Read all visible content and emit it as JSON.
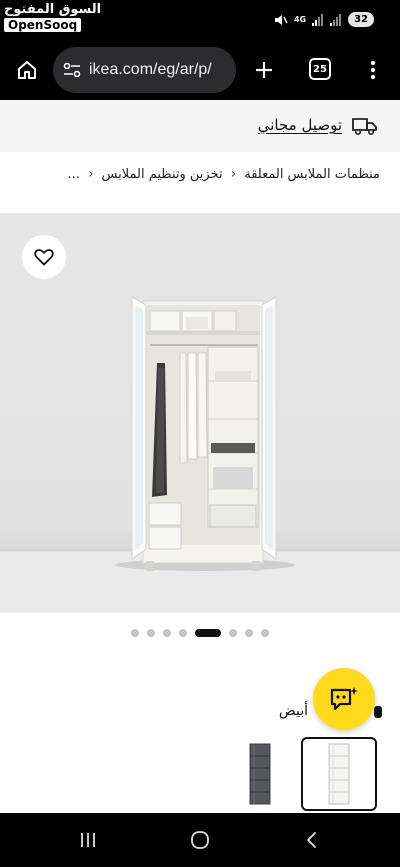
{
  "status_bar": {
    "watermark_ar": "السوق المفتوح",
    "watermark_en": "OpenSooq",
    "network": "4G",
    "battery": "32"
  },
  "browser": {
    "url": "ikea.com/eg/ar/p/",
    "tab_count": "25"
  },
  "delivery_banner": {
    "text": "توصيل مجاني"
  },
  "breadcrumb": {
    "items": [
      "...",
      "تخزين وتنظيم الملابس",
      "منظمات الملابس المعلقة"
    ]
  },
  "gallery": {
    "image_count": 8,
    "active_index": 4
  },
  "product": {
    "color_label": "أبيض",
    "variants": [
      {
        "name": "white-hanging-organizer",
        "selected": true
      },
      {
        "name": "gray-hanging-organizer",
        "selected": false
      }
    ]
  },
  "colors": {
    "accent_yellow": "#ffda1a",
    "status_bg": "#000000",
    "banner_bg": "#f5f5f5"
  },
  "icons": [
    "home-icon",
    "site-settings-icon",
    "add-tab-icon",
    "tab-count-icon",
    "more-icon",
    "delivery-truck-icon",
    "favorite-heart-icon",
    "chat-assistant-icon",
    "recents-icon",
    "home-nav-icon",
    "back-icon"
  ]
}
